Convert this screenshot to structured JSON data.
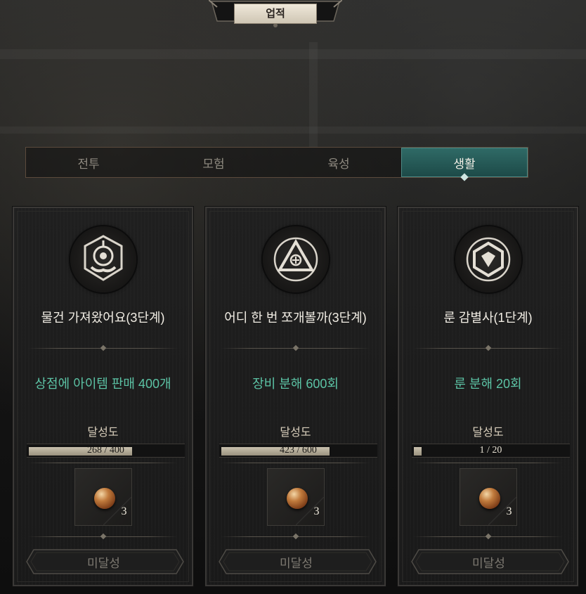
{
  "header": {
    "title": "업적"
  },
  "tabs": [
    {
      "label": "전투",
      "active": false
    },
    {
      "label": "모험",
      "active": false
    },
    {
      "label": "육성",
      "active": false
    },
    {
      "label": "생활",
      "active": true
    }
  ],
  "colors": {
    "accent_tab": "#2f6a66",
    "description": "#5cc3a5",
    "progress": "#c9c1ae"
  },
  "cards": [
    {
      "icon": "merchant-emblem-icon",
      "name": "물건 가져왔어요(3단계)",
      "description": "상점에 아이템 판매 400개",
      "progress_label": "달성도",
      "progress_text": "268 / 400",
      "progress_fraction": 0.67,
      "reward_count": "3",
      "reward_icon": "bronze-coin-icon",
      "button_label": "미달성"
    },
    {
      "icon": "dismantle-emblem-icon",
      "name": "어디 한 번 쪼개볼까(3단계)",
      "description": "장비 분해 600회",
      "progress_label": "달성도",
      "progress_text": "423 / 600",
      "progress_fraction": 0.705,
      "reward_count": "3",
      "reward_icon": "bronze-coin-icon",
      "button_label": "미달성"
    },
    {
      "icon": "rune-emblem-icon",
      "name": "룬 감별사(1단계)",
      "description": "룬 분해 20회",
      "progress_label": "달성도",
      "progress_text": "1 / 20",
      "progress_fraction": 0.05,
      "reward_count": "3",
      "reward_icon": "bronze-coin-icon",
      "button_label": "미달성"
    }
  ]
}
